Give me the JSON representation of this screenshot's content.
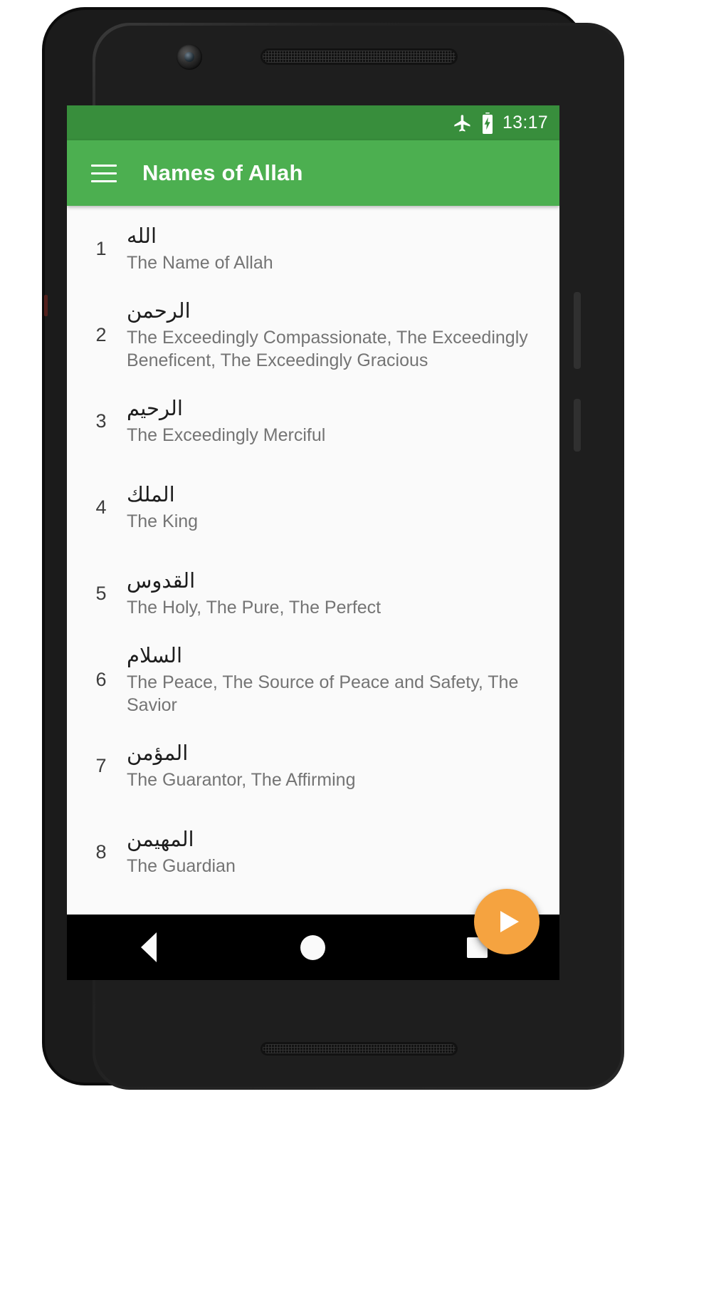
{
  "status_bar": {
    "time": "13:17",
    "icons": [
      "airplane-mode-icon",
      "battery-charging-icon"
    ],
    "background_color": "#388e3c",
    "text_color": "#ffffff"
  },
  "app_bar": {
    "menu_icon": "hamburger-menu-icon",
    "title": "Names of Allah",
    "background_color": "#4caf50",
    "title_color": "#ffffff"
  },
  "list": {
    "items": [
      {
        "index": "1",
        "arabic": "الله",
        "meaning": "The Name of Allah"
      },
      {
        "index": "2",
        "arabic": "الرحمن",
        "meaning": "The Exceedingly Compassionate, The Exceedingly Beneficent, The Exceedingly Gracious"
      },
      {
        "index": "3",
        "arabic": "الرحيم",
        "meaning": "The Exceedingly Merciful"
      },
      {
        "index": "4",
        "arabic": "الملك",
        "meaning": "The King"
      },
      {
        "index": "5",
        "arabic": "القدوس",
        "meaning": "The Holy, The Pure, The Perfect"
      },
      {
        "index": "6",
        "arabic": "السلام",
        "meaning": "The Peace, The Source of Peace and Safety, The Savior"
      },
      {
        "index": "7",
        "arabic": "المؤمن",
        "meaning": "The Guarantor, The Affirming"
      },
      {
        "index": "8",
        "arabic": "المهيمن",
        "meaning": "The Guardian"
      }
    ]
  },
  "fab": {
    "icon": "play-icon",
    "color": "#f5a340"
  },
  "navigation_bar": {
    "buttons": [
      "back-icon",
      "home-icon",
      "recents-icon"
    ],
    "background_color": "#000000"
  }
}
